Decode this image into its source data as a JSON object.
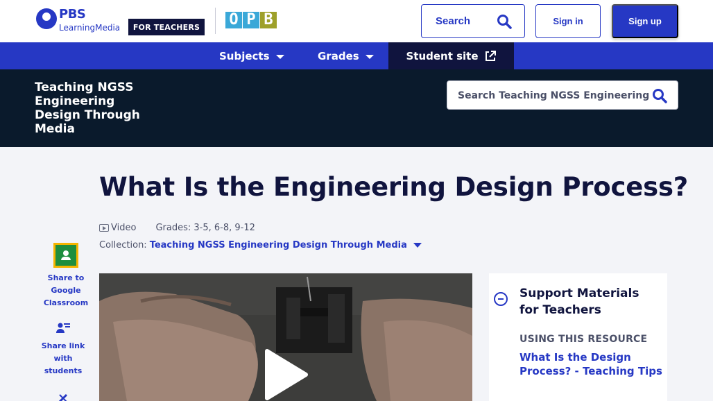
{
  "header": {
    "logo": {
      "brand": "PBS",
      "product": "LearningMedia"
    },
    "audience_badge": "FOR TEACHERS",
    "station_logo_letters": [
      "O",
      "P",
      "B"
    ],
    "search_label": "Search",
    "sign_in_label": "Sign in",
    "sign_up_label": "Sign up"
  },
  "nav": {
    "subjects": "Subjects",
    "grades": "Grades",
    "student_site": "Student site"
  },
  "collection_banner": {
    "title": "Teaching NGSS Engineering Design Through Media",
    "search_placeholder": "Search Teaching NGSS Engineering …"
  },
  "resource": {
    "title": "What Is the Engineering Design Process?",
    "media_type": "Video",
    "grades": "Grades: 3-5, 6-8, 9-12",
    "collection_prefix": "Collection:",
    "collection_name": "Teaching NGSS Engineering Design Through Media"
  },
  "share": {
    "google_classroom": "Share to Google Classroom",
    "students_link": "Share link with students"
  },
  "support_panel": {
    "heading": "Support Materials for Teachers",
    "eyebrow": "USING THIS RESOURCE",
    "link": "What Is the Design Process? - Teaching Tips"
  },
  "colors": {
    "brand_blue": "#2638c4",
    "navy": "#10143e",
    "banner_dark": "#0a1a2c",
    "page_bg": "#f3f4f8",
    "station_blue": "#3aa8d8",
    "station_olive": "#9ea02a",
    "classroom_green": "#1e8e3e",
    "classroom_yellow": "#f4b400"
  },
  "icons": {
    "search": "search-icon",
    "external_link": "external-link-icon",
    "video": "video-icon",
    "google_classroom": "google-classroom-icon",
    "share_students": "share-students-icon",
    "play": "play-icon",
    "collapse": "minus-circle-icon"
  }
}
